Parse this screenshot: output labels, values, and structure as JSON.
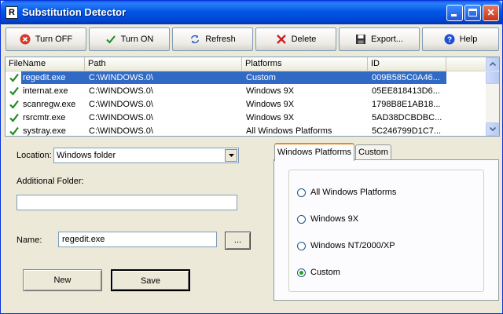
{
  "window": {
    "title": "Substitution Detector",
    "app_icon_glyph": "R"
  },
  "toolbar": {
    "turn_off": {
      "label": "Turn OFF",
      "icon": "stop-circle-icon",
      "color": "#cc2222"
    },
    "turn_on": {
      "label": "Turn ON",
      "icon": "checkmark-icon",
      "color": "#1f8a1f"
    },
    "refresh": {
      "label": "Refresh",
      "icon": "refresh-icon"
    },
    "delete": {
      "label": "Delete",
      "icon": "delete-x-icon",
      "color": "#cc2222"
    },
    "export": {
      "label": "Export...",
      "icon": "floppy-disk-icon"
    },
    "help": {
      "label": "Help",
      "icon": "help-icon",
      "color": "#1f4fd4"
    }
  },
  "list": {
    "columns": [
      "FileName",
      "Path",
      "Platforms",
      "ID"
    ],
    "rows": [
      {
        "file": "regedit.exe",
        "path": "C:\\WINDOWS.0\\",
        "platforms": "Custom",
        "id": "009B585C0A46...",
        "selected": true
      },
      {
        "file": "internat.exe",
        "path": "C:\\WINDOWS.0\\",
        "platforms": "Windows 9X",
        "id": "05EE818413D6...",
        "selected": false
      },
      {
        "file": "scanregw.exe",
        "path": "C:\\WINDOWS.0\\",
        "platforms": "Windows 9X",
        "id": "1798B8E1AB18...",
        "selected": false
      },
      {
        "file": "rsrcmtr.exe",
        "path": "C:\\WINDOWS.0\\",
        "platforms": "Windows 9X",
        "id": "5AD38DCBDBC...",
        "selected": false
      },
      {
        "file": "systray.exe",
        "path": "C:\\WINDOWS.0\\",
        "platforms": "All Windows Platforms",
        "id": "5C246799D1C7...",
        "selected": false
      }
    ]
  },
  "form": {
    "location_label": "Location:",
    "location_value": "Windows folder",
    "additional_folder_label": "Additional Folder:",
    "additional_folder_value": "",
    "name_label": "Name:",
    "name_value": "regedit.exe",
    "browse_label": "...",
    "new_label": "New",
    "save_label": "Save"
  },
  "tabs": {
    "items": [
      "Windows Platforms",
      "Custom"
    ],
    "active": 0
  },
  "platform_options": {
    "items": [
      "All Windows Platforms",
      "Windows 9X",
      "Windows NT/2000/XP",
      "Custom"
    ],
    "selected_index": 3
  }
}
